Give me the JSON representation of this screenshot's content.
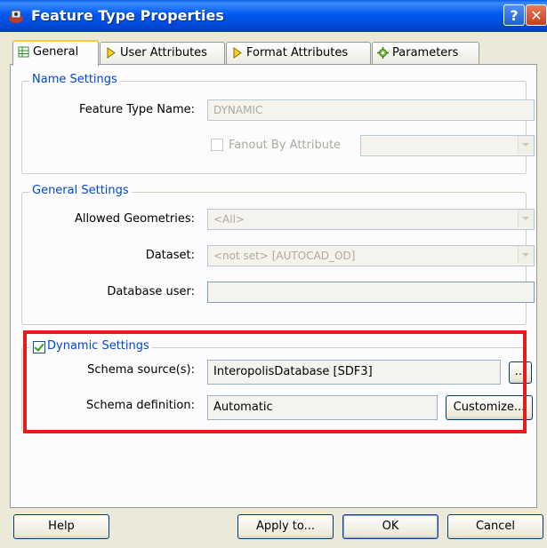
{
  "window": {
    "title": "Feature Type Properties",
    "help_glyph": "?",
    "close_glyph": "✕"
  },
  "tabs": [
    {
      "label": "General",
      "icon": "table-icon"
    },
    {
      "label": "User Attributes",
      "icon": "diamond-icon"
    },
    {
      "label": "Format Attributes",
      "icon": "diamond-icon"
    },
    {
      "label": "Parameters",
      "icon": "gear-icon"
    }
  ],
  "name_settings": {
    "legend": "Name Settings",
    "feature_type_name_label": "Feature Type Name:",
    "feature_type_name_value": "DYNAMIC",
    "fanout_label": "Fanout By Attribute",
    "fanout_checked": false,
    "fanout_value": ""
  },
  "general_settings": {
    "legend": "General Settings",
    "allowed_geometries_label": "Allowed Geometries:",
    "allowed_geometries_value": "<All>",
    "dataset_label": "Dataset:",
    "dataset_value": "<not set> [AUTOCAD_OD]",
    "database_user_label": "Database user:",
    "database_user_value": ""
  },
  "dynamic_settings": {
    "legend": "Dynamic Settings",
    "checked": true,
    "schema_source_label": "Schema source(s):",
    "schema_source_value": "InteropolisDatabase [SDF3]",
    "browse_label": "...",
    "schema_definition_label": "Schema definition:",
    "schema_definition_value": "Automatic",
    "customize_label": "Customize..."
  },
  "footer": {
    "help_label": "Help",
    "apply_label": "Apply to...",
    "ok_label": "OK",
    "cancel_label": "Cancel"
  },
  "colors": {
    "highlight_box": "#e41c1c",
    "group_legend": "#0046d5",
    "titlebar": "#0058ee"
  }
}
